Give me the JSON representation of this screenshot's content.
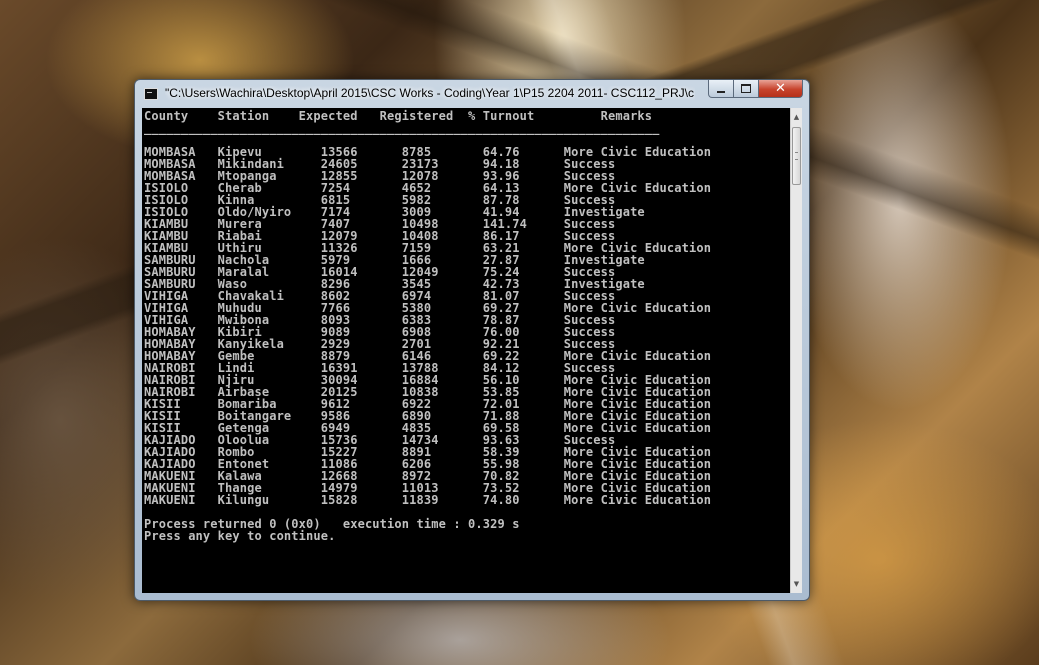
{
  "window": {
    "title": "\"C:\\Users\\Wachira\\Desktop\\April 2015\\CSC Works - Coding\\Year 1\\P15 2204 2011- CSC112_PRJ\\c...",
    "icons": {
      "app": "console-icon",
      "minimize": "minimize-icon",
      "maximize": "maximize-icon",
      "close": "close-icon"
    },
    "close_glyph": "✕"
  },
  "console": {
    "header": "County    Station    Expected   Registered  % Turnout         Remarks",
    "rule": "                                                                  ______________________________________________________________________",
    "rows": [
      "MOMBASA   Kipevu        13566      8785       64.76      More Civic Education",
      "MOMBASA   Mikindani     24605      23173      94.18      Success",
      "MOMBASA   Mtopanga      12855      12078      93.96      Success",
      "ISIOLO    Cherab        7254       4652       64.13      More Civic Education",
      "ISIOLO    Kinna         6815       5982       87.78      Success",
      "ISIOLO    Oldo/Nyiro    7174       3009       41.94      Investigate",
      "KIAMBU    Murera        7407       10498      141.74     Success",
      "KIAMBU    Riabai        12079      10408      86.17      Success",
      "KIAMBU    Uthiru        11326      7159       63.21      More Civic Education",
      "SAMBURU   Nachola       5979       1666       27.87      Investigate",
      "SAMBURU   Maralal       16014      12049      75.24      Success",
      "SAMBURU   Waso          8296       3545       42.73      Investigate",
      "VIHIGA    Chavakali     8602       6974       81.07      Success",
      "VIHIGA    Muhudu        7766       5380       69.27      More Civic Education",
      "VIHIGA    Mwibona       8093       6383       78.87      Success",
      "HOMABAY   Kibiri        9089       6908       76.00      Success",
      "HOMABAY   Kanyikela     2929       2701       92.21      Success",
      "HOMABAY   Gembe         8879       6146       69.22      More Civic Education",
      "NAIROBI   Lindi         16391      13788      84.12      Success",
      "NAIROBI   Njiru         30094      16884      56.10      More Civic Education",
      "NAIROBI   Airbase       20125      10838      53.85      More Civic Education",
      "KISII     Bomariba      9612       6922       72.01      More Civic Education",
      "KISII     Boitangare    9586       6890       71.88      More Civic Education",
      "KISII     Getenga       6949       4835       69.58      More Civic Education",
      "KAJIADO   Oloolua       15736      14734      93.63      Success",
      "KAJIADO   Rombo         15227      8891       58.39      More Civic Education",
      "KAJIADO   Entonet       11086      6206       55.98      More Civic Education",
      "MAKUENI   Kalawa        12668      8972       70.82      More Civic Education",
      "MAKUENI   Thange        14979      11013      73.52      More Civic Education",
      "MAKUENI   Kilungu       15828      11839      74.80      More Civic Education"
    ],
    "process_line": "Process returned 0 (0x0)   execution time : 0.329 s",
    "continue_line": "Press any key to continue."
  },
  "scrollbar": {
    "up_arrow": "▲",
    "down_arrow": "▼"
  }
}
